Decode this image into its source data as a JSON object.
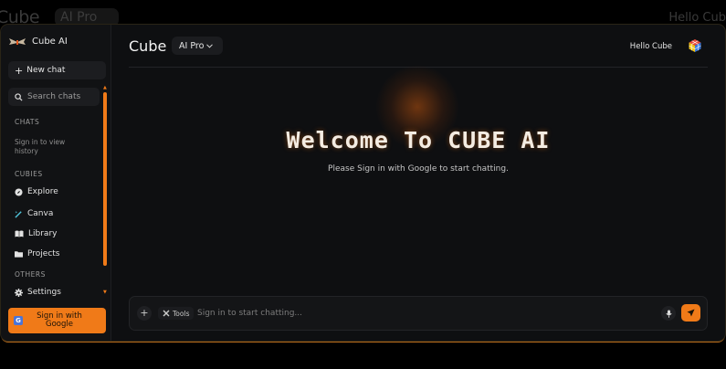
{
  "background": {
    "brand": "Cube",
    "model": "AI Pro",
    "greeting": "Hello Cube"
  },
  "colors": {
    "accent": "#f07a18",
    "window_bg": "#0e0f11",
    "sidebar_bg": "#111214"
  },
  "sidebar": {
    "brand": "Cube AI",
    "new_chat": "New chat",
    "search_placeholder": "Search chats",
    "sections": {
      "chats": "CHATS",
      "cubies": "CUBIES",
      "others": "OTHERS"
    },
    "chats_note": "Sign in to view history",
    "items": [
      {
        "label": "Explore",
        "icon": "compass-icon"
      },
      {
        "label": "Canva",
        "icon": "magic-wand-icon"
      },
      {
        "label": "Library",
        "icon": "book-icon"
      },
      {
        "label": "Projects",
        "icon": "folder-icon"
      },
      {
        "label": "Settings",
        "icon": "gear-icon"
      }
    ],
    "signin_label": "Sign in with Google"
  },
  "header": {
    "brand": "Cube",
    "model_selector": "AI Pro",
    "greeting": "Hello Cube"
  },
  "main": {
    "welcome": "Welcome To CUBE AI",
    "subtitle": "Please Sign in with Google to start chatting."
  },
  "composer": {
    "tools_label": "Tools",
    "placeholder": "Sign in to start chatting..."
  }
}
